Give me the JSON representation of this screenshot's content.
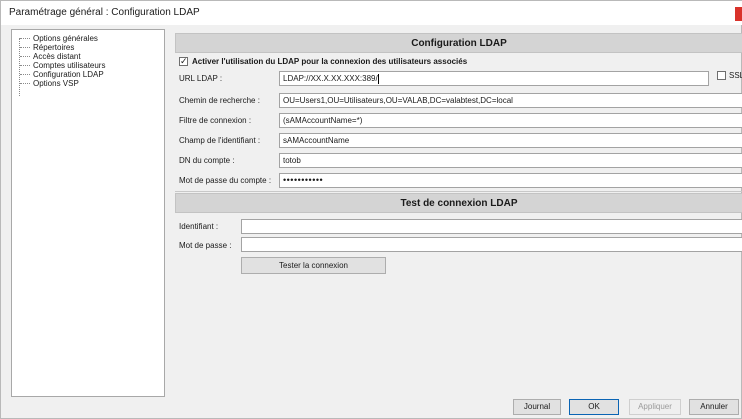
{
  "window": {
    "title": "Paramétrage général : Configuration LDAP"
  },
  "nav": {
    "items": [
      "Options générales",
      "Répertoires",
      "Accès distant",
      "Comptes utilisateurs",
      "Configuration LDAP",
      "Options VSP"
    ]
  },
  "ldap": {
    "header": "Configuration LDAP",
    "enable_label": "Activer l'utilisation du LDAP pour la connexion des utilisateurs associés",
    "url_label": "URL LDAP :",
    "url_value": "LDAP://XX.X.XX.XXX:389/",
    "ssl_label": "SSL",
    "search_path_label": "Chemin de recherche :",
    "search_path_value": "OU=Users1,OU=Utilisateurs,OU=VALAB,DC=valabtest,DC=local",
    "filter_label": "Filtre de connexion :",
    "filter_value": "(sAMAccountName=*)",
    "id_field_label": "Champ de l'identifiant :",
    "id_field_value": "sAMAccountName",
    "dn_label": "DN du compte :",
    "dn_value": "totob",
    "password_label": "Mot de passe du compte :",
    "password_value": "•••••••••••"
  },
  "test": {
    "header": "Test de connexion LDAP",
    "identifier_label": "Identifiant :",
    "identifier_value": "",
    "password_label": "Mot de passe :",
    "password_value": "",
    "test_button": "Tester la connexion"
  },
  "footer": {
    "journal": "Journal",
    "ok": "OK",
    "apply": "Appliquer",
    "cancel": "Annuler"
  },
  "colors": {
    "close_button": "#d9322b",
    "section_header": "#d4d4d4"
  }
}
